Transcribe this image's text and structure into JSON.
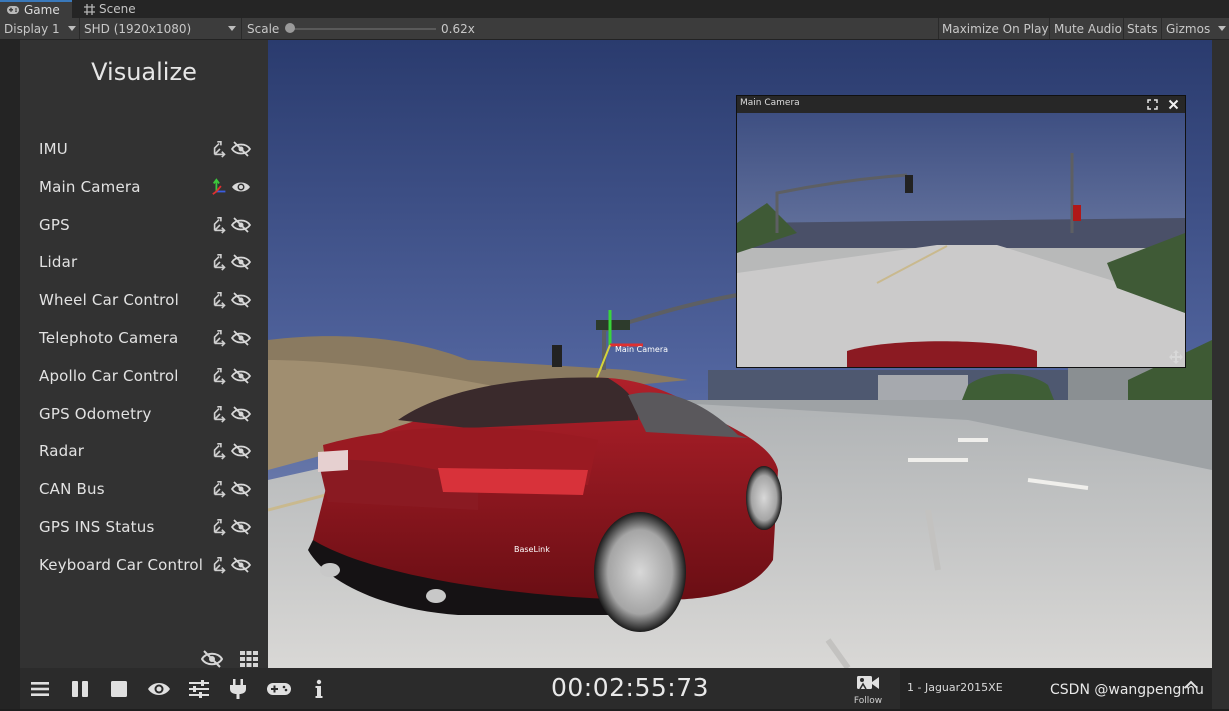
{
  "tabs": [
    {
      "label": "Game",
      "icon": "gamepad-icon",
      "active": true
    },
    {
      "label": "Scene",
      "icon": "grid-icon",
      "active": false
    }
  ],
  "toolbar": {
    "display": "Display 1",
    "resolution": "SHD (1920x1080)",
    "scale_label": "Scale",
    "scale_value": "0.62x",
    "maximize": "Maximize On Play",
    "mute": "Mute Audio",
    "stats": "Stats",
    "gizmos": "Gizmos"
  },
  "panel": {
    "title": "Visualize",
    "items": [
      {
        "label": "IMU",
        "axis_colored": false,
        "visible": false
      },
      {
        "label": "Main Camera",
        "axis_colored": true,
        "visible": true
      },
      {
        "label": "GPS",
        "axis_colored": false,
        "visible": false
      },
      {
        "label": "Lidar",
        "axis_colored": false,
        "visible": false
      },
      {
        "label": "Wheel Car Control",
        "axis_colored": false,
        "visible": false
      },
      {
        "label": "Telephoto Camera",
        "axis_colored": false,
        "visible": false
      },
      {
        "label": "Apollo Car Control",
        "axis_colored": false,
        "visible": false
      },
      {
        "label": "GPS Odometry",
        "axis_colored": false,
        "visible": false
      },
      {
        "label": "Radar",
        "axis_colored": false,
        "visible": false
      },
      {
        "label": "CAN Bus",
        "axis_colored": false,
        "visible": false
      },
      {
        "label": "GPS INS Status",
        "axis_colored": false,
        "visible": false
      },
      {
        "label": "Keyboard Car Control",
        "axis_colored": false,
        "visible": false
      }
    ]
  },
  "bottom": {
    "timer": "00:02:55:73",
    "follow_label": "Follow",
    "vehicle": "1 - Jaguar2015XE",
    "watermark": "CSDN @wangpengmu"
  },
  "scene": {
    "camera_window_title": "Main Camera",
    "sensor_label": "Main Camera",
    "baselink_label": "BaseLink"
  }
}
